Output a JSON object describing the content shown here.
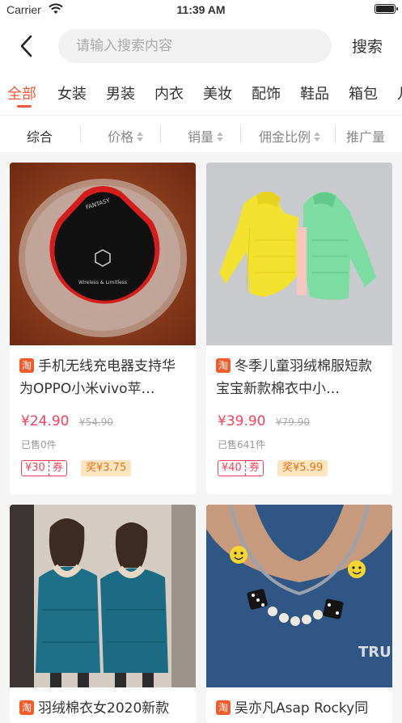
{
  "status": {
    "carrier": "Carrier",
    "time": "11:39 AM"
  },
  "search": {
    "placeholder": "请输入搜索内容",
    "button": "搜索"
  },
  "categories": [
    "全部",
    "女装",
    "男装",
    "内衣",
    "美妆",
    "配饰",
    "鞋品",
    "箱包",
    "儿"
  ],
  "sort": {
    "items": [
      "综合",
      "价格",
      "销量",
      "佣金比例",
      "推广量"
    ]
  },
  "badge": "淘",
  "products": [
    {
      "title": "手机无线充电器支持华为OPPO小米vivo苹…",
      "price": "¥24.90",
      "orig": "¥54.90",
      "sold": "已售0件",
      "coupon": "¥30",
      "coupon_label": "券",
      "reward": "奖¥3.75",
      "image_text": [
        "FANTASY",
        "Wireless & Limitless"
      ]
    },
    {
      "title": "冬季儿童羽绒棉服短款宝宝新款棉衣中小…",
      "price": "¥39.90",
      "orig": "¥79.90",
      "sold": "已售641件",
      "coupon": "¥40",
      "coupon_label": "券",
      "reward": "奖¥5.99"
    },
    {
      "title": "羽绒棉衣女2020新款"
    },
    {
      "title": "吴亦凡Asap Rocky同",
      "image_text": [
        "TRUS"
      ]
    }
  ],
  "colors": {
    "accent": "#f05a3c",
    "price": "#f0425b",
    "reward_bg": "#fde6bf"
  }
}
